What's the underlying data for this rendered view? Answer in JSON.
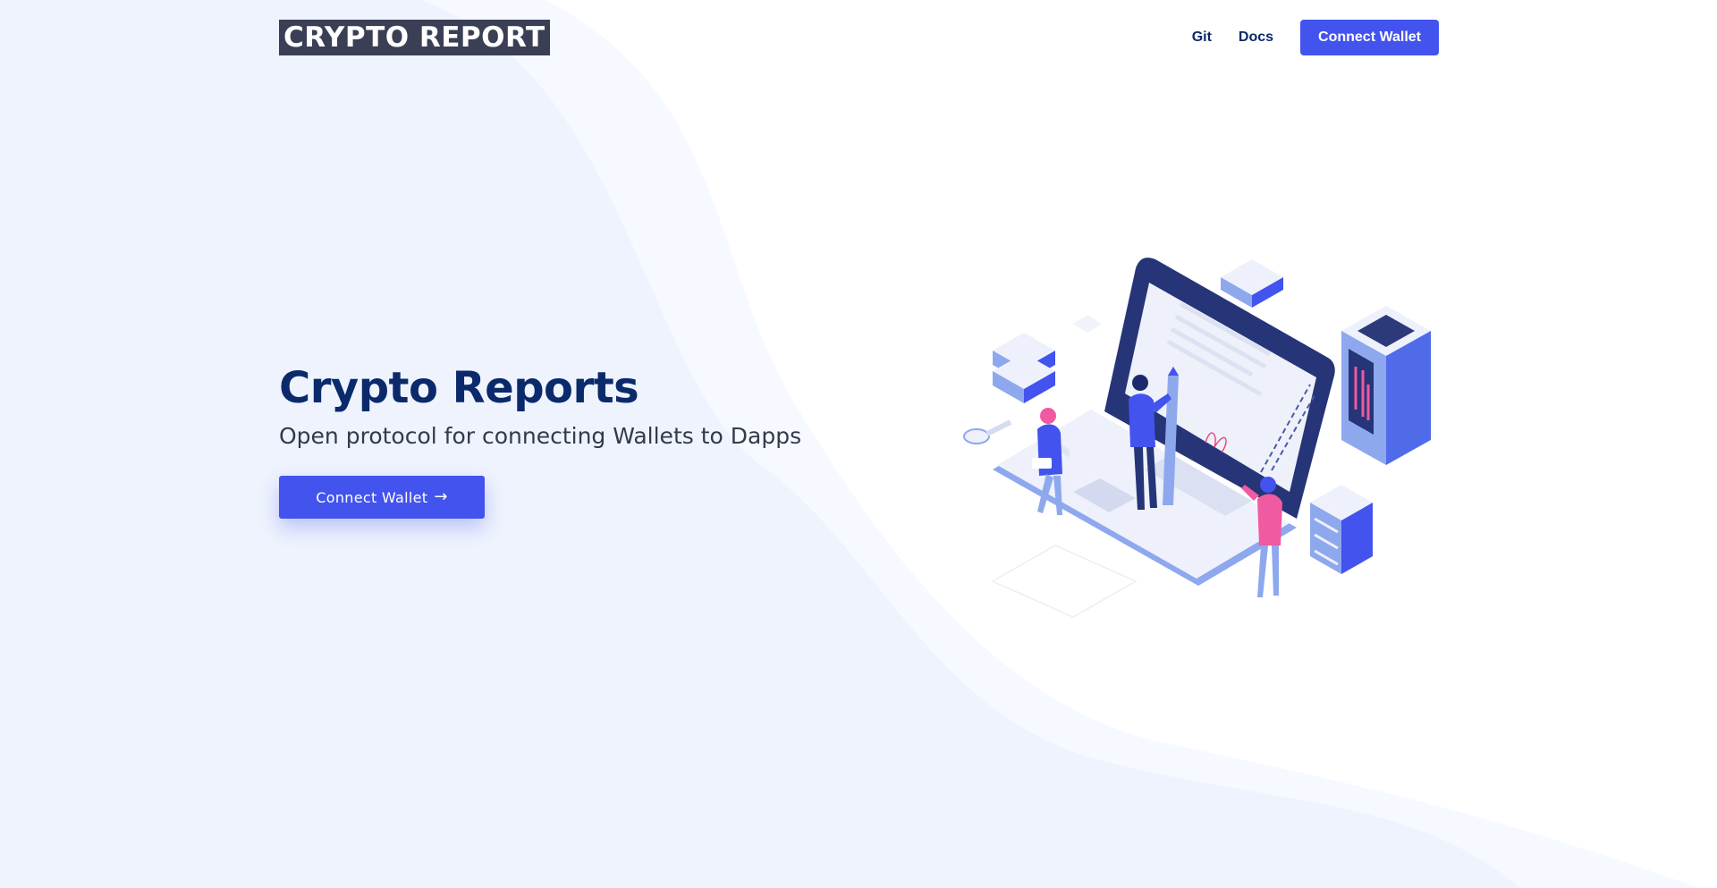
{
  "header": {
    "logo_text": "CRYPTO REPORT",
    "nav": {
      "git": "Git",
      "docs": "Docs",
      "connect_wallet": "Connect Wallet"
    }
  },
  "hero": {
    "title": "Crypto Reports",
    "subtitle": "Open protocol for connecting Wallets to Dapps",
    "cta_label": "Connect Wallet",
    "cta_icon": "arrow-right-icon"
  },
  "colors": {
    "accent": "#4353ee",
    "heading": "#0b2a6b",
    "body_text": "#333a4a",
    "background_wave": "#eef3fd",
    "logo_bg": "#3b3f55"
  }
}
